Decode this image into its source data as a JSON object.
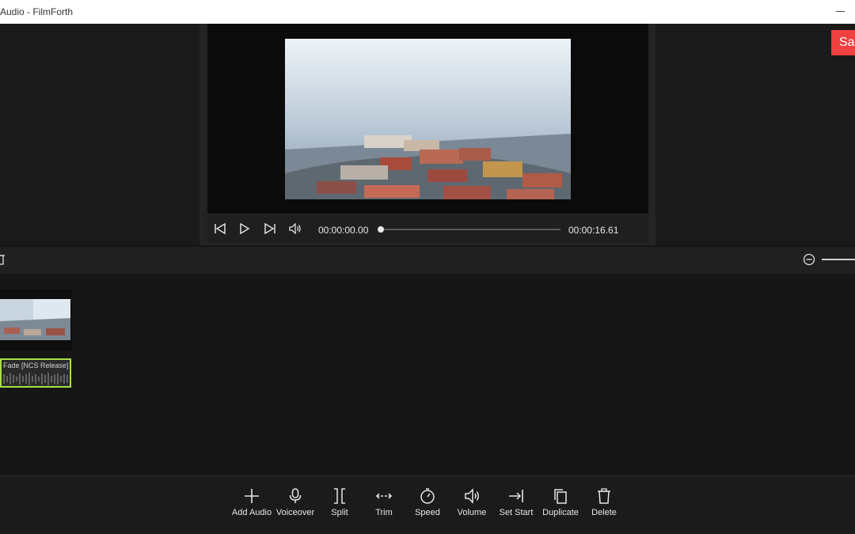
{
  "window": {
    "title": "Audio - FilmForth"
  },
  "header": {
    "save_label": "Sa"
  },
  "player": {
    "current_time": "00:00:00.00",
    "total_time": "00:00:16.61",
    "progress": 0
  },
  "timeline": {
    "audio_clip_label": "Fade [NCS Release]"
  },
  "toolbar": {
    "items": [
      {
        "label": "Add Audio",
        "icon": "plus-icon"
      },
      {
        "label": "Voiceover",
        "icon": "microphone-icon"
      },
      {
        "label": "Split",
        "icon": "split-icon"
      },
      {
        "label": "Trim",
        "icon": "trim-icon"
      },
      {
        "label": "Speed",
        "icon": "speed-icon"
      },
      {
        "label": "Volume",
        "icon": "volume-icon"
      },
      {
        "label": "Set Start",
        "icon": "set-start-icon"
      },
      {
        "label": "Duplicate",
        "icon": "duplicate-icon"
      },
      {
        "label": "Delete",
        "icon": "trash-icon"
      }
    ]
  },
  "colors": {
    "accent_red": "#f04040",
    "selection_green": "#a8e04a"
  }
}
